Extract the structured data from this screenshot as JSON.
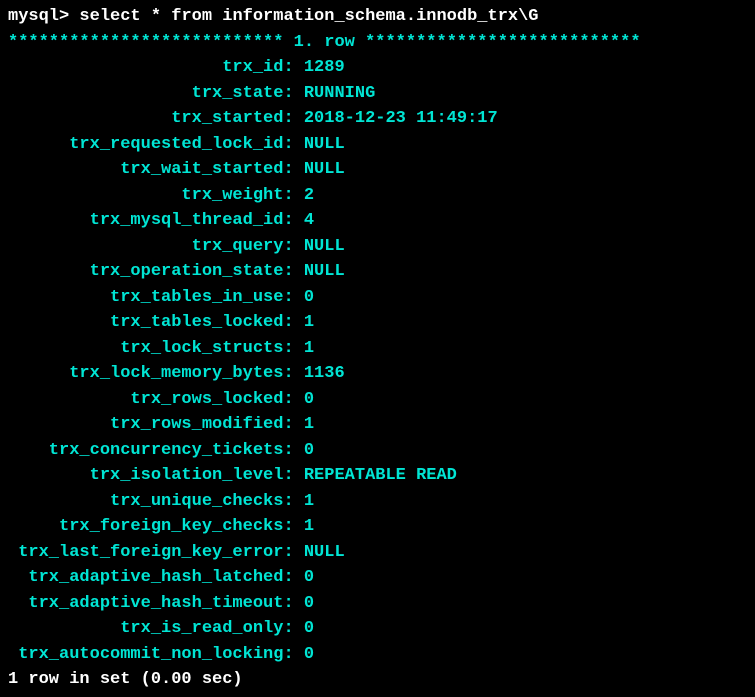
{
  "prompt": "mysql>",
  "command": "select * from information_schema.innodb_trx\\G",
  "separator_left": "***************************",
  "separator_mid": " 1. row ",
  "separator_right": "***************************",
  "label_width": 27,
  "fields": [
    {
      "label": "trx_id",
      "value": "1289"
    },
    {
      "label": "trx_state",
      "value": "RUNNING"
    },
    {
      "label": "trx_started",
      "value": "2018-12-23 11:49:17"
    },
    {
      "label": "trx_requested_lock_id",
      "value": "NULL"
    },
    {
      "label": "trx_wait_started",
      "value": "NULL"
    },
    {
      "label": "trx_weight",
      "value": "2"
    },
    {
      "label": "trx_mysql_thread_id",
      "value": "4"
    },
    {
      "label": "trx_query",
      "value": "NULL"
    },
    {
      "label": "trx_operation_state",
      "value": "NULL"
    },
    {
      "label": "trx_tables_in_use",
      "value": "0"
    },
    {
      "label": "trx_tables_locked",
      "value": "1"
    },
    {
      "label": "trx_lock_structs",
      "value": "1"
    },
    {
      "label": "trx_lock_memory_bytes",
      "value": "1136"
    },
    {
      "label": "trx_rows_locked",
      "value": "0"
    },
    {
      "label": "trx_rows_modified",
      "value": "1"
    },
    {
      "label": "trx_concurrency_tickets",
      "value": "0"
    },
    {
      "label": "trx_isolation_level",
      "value": "REPEATABLE READ"
    },
    {
      "label": "trx_unique_checks",
      "value": "1"
    },
    {
      "label": "trx_foreign_key_checks",
      "value": "1"
    },
    {
      "label": "trx_last_foreign_key_error",
      "value": "NULL"
    },
    {
      "label": "trx_adaptive_hash_latched",
      "value": "0"
    },
    {
      "label": "trx_adaptive_hash_timeout",
      "value": "0"
    },
    {
      "label": "trx_is_read_only",
      "value": "0"
    },
    {
      "label": "trx_autocommit_non_locking",
      "value": "0"
    }
  ],
  "footer": "1 row in set (0.00 sec)"
}
